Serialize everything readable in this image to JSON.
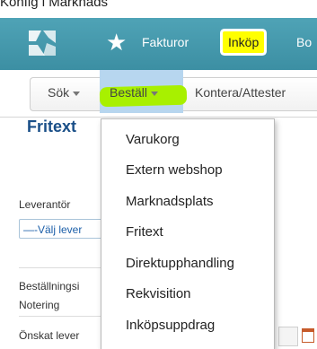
{
  "caption": "Konfig i Marknads",
  "nav": {
    "fakturor": "Fakturor",
    "inkop": "Inköp",
    "partial": "Bo"
  },
  "subnav": {
    "sok": "Sök",
    "bestall": "Beställ",
    "kontera": "Kontera/Attester"
  },
  "page": {
    "title": "Fritext",
    "leverantor_label": "Leverantör",
    "leverantor_select": "—-Välj lever",
    "bestallning_label": "Beställningsi",
    "notering_label": "Notering",
    "onskat_label": "Önskat lever"
  },
  "dropdown": {
    "items": [
      "Varukorg",
      "Extern webshop",
      "Marknadsplats",
      "Fritext",
      "Direktupphandling",
      "Rekvisition",
      "Inköpsuppdrag"
    ],
    "highlighted": "Fritext"
  },
  "colors": {
    "topbar": "#4fa3b6",
    "highlight_yellow": "#ffff00",
    "highlight_green": "#a8f000",
    "title_blue": "#1a4f88"
  }
}
